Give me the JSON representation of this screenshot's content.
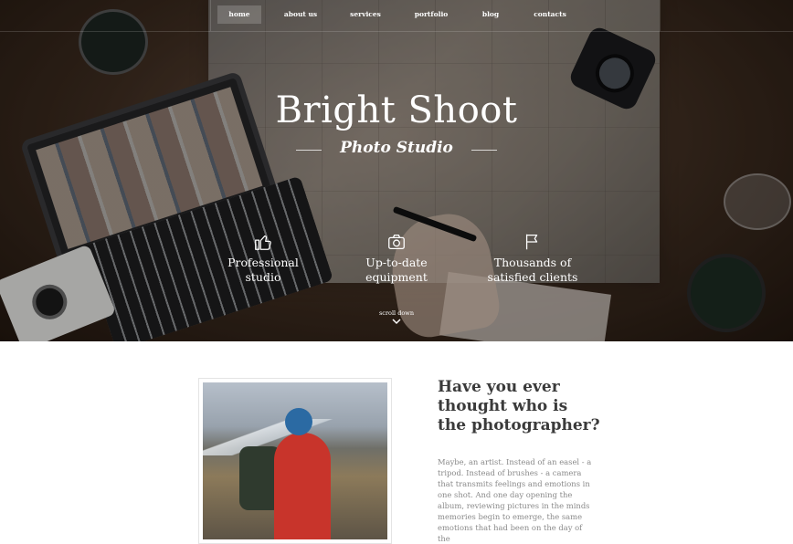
{
  "nav": {
    "items": [
      {
        "label": "home",
        "active": true
      },
      {
        "label": "about us",
        "active": false
      },
      {
        "label": "services",
        "active": false
      },
      {
        "label": "portfolio",
        "active": false
      },
      {
        "label": "blog",
        "active": false
      },
      {
        "label": "contacts",
        "active": false
      }
    ]
  },
  "hero": {
    "title": "Bright Shoot",
    "subtitle": "Photo Studio",
    "features": [
      {
        "icon": "thumbs-up-icon",
        "label": "Professional\nstudio"
      },
      {
        "icon": "camera-icon",
        "label": "Up-to-date\nequipment"
      },
      {
        "icon": "flag-icon",
        "label": "Thousands of\nsatisfied clients"
      }
    ],
    "scroll_label": "scroll down"
  },
  "about": {
    "heading": "Have you ever\nthought who is\nthe photographer?",
    "text": "Maybe, an artist. Instead of an easel - a tripod. Instead of brushes - a camera that transmits feelings and emotions in one shot. And one day opening the album, reviewing pictures in the minds memories begin to emerge, the same emotions that had been on the day of the"
  },
  "colors": {
    "text_light": "#ffffff",
    "heading_dark": "#3a3a3a",
    "body_gray": "#8a8a8a"
  }
}
